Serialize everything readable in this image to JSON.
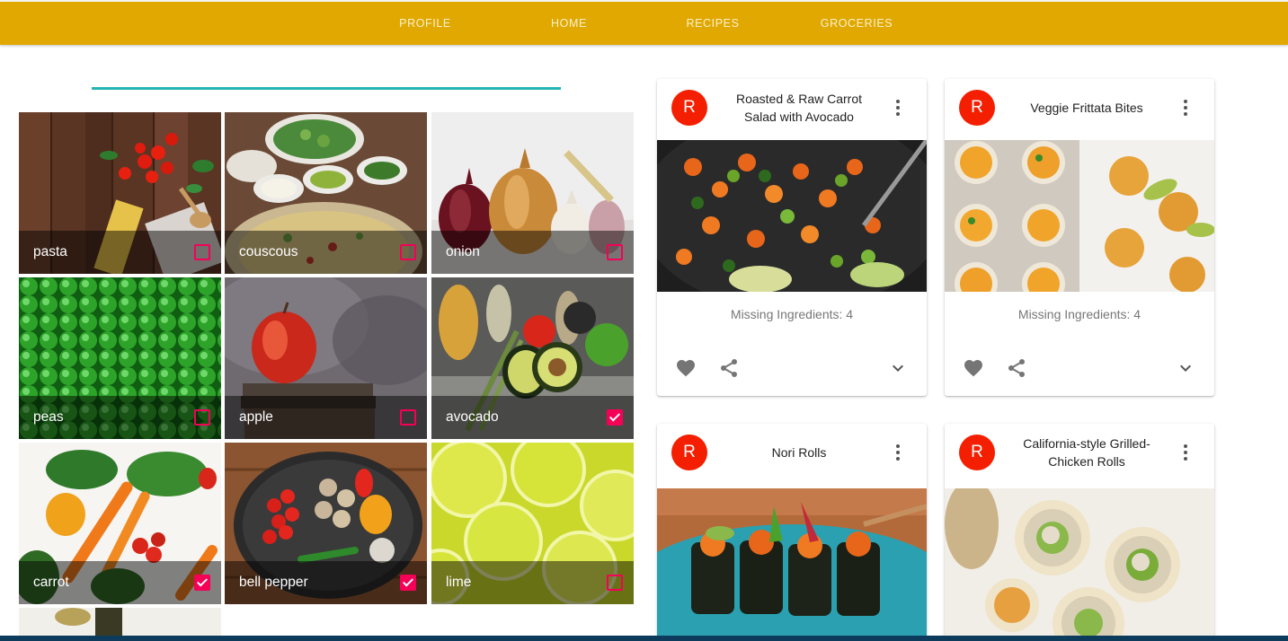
{
  "nav": {
    "items": [
      "PROFILE",
      "HOME",
      "RECIPES",
      "GROCERIES"
    ]
  },
  "ingredients": [
    {
      "label": "pasta",
      "checked": false
    },
    {
      "label": "couscous",
      "checked": false
    },
    {
      "label": "onion",
      "checked": false
    },
    {
      "label": "peas",
      "checked": false
    },
    {
      "label": "apple",
      "checked": false
    },
    {
      "label": "avocado",
      "checked": true
    },
    {
      "label": "carrot",
      "checked": true
    },
    {
      "label": "bell pepper",
      "checked": true
    },
    {
      "label": "lime",
      "checked": false
    }
  ],
  "recipes": [
    {
      "avatar": "R",
      "title": "Roasted & Raw Carrot Salad with Avocado",
      "missing": "Missing Ingredients: 4"
    },
    {
      "avatar": "R",
      "title": "Veggie Frittata Bites",
      "missing": "Missing Ingredients: 4"
    },
    {
      "avatar": "R",
      "title": "Nori Rolls",
      "missing": ""
    },
    {
      "avatar": "R",
      "title": "California-style Grilled-Chicken Rolls",
      "missing": ""
    }
  ],
  "colors": {
    "nav_bg": "#e0a800",
    "accent_check": "#f50057",
    "avatar_bg": "#f41f00",
    "heading_rule": "#26b3b3"
  },
  "icons": {
    "card_more": "more-vert-icon",
    "favorite": "heart-icon",
    "share": "share-icon",
    "expand": "chevron-down-icon"
  }
}
